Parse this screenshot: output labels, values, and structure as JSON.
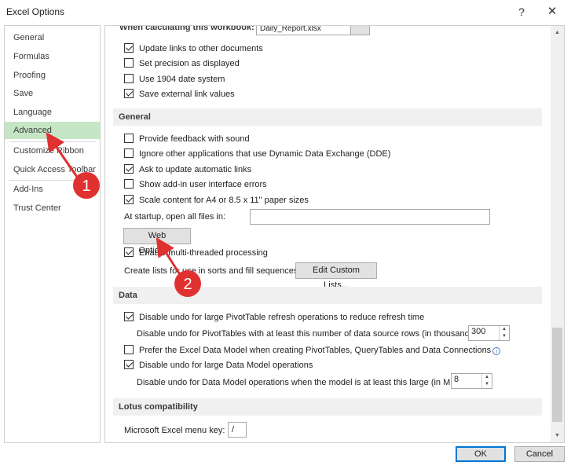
{
  "window": {
    "title": "Excel Options",
    "help_glyph": "?",
    "close_glyph": "✕"
  },
  "sidebar": {
    "items": [
      {
        "label": "General"
      },
      {
        "label": "Formulas"
      },
      {
        "label": "Proofing"
      },
      {
        "label": "Save"
      },
      {
        "label": "Language"
      },
      {
        "label": "Advanced",
        "selected": true
      },
      {
        "label": "Customize Ribbon"
      },
      {
        "label": "Quick Access Toolbar"
      },
      {
        "label": "Add-Ins"
      },
      {
        "label": "Trust Center"
      }
    ]
  },
  "workbook": {
    "cut_header": "When calculating this workbook:",
    "combo_value": "Daily_Report.xlsx",
    "options": [
      {
        "label": "Update links to other documents",
        "checked": true
      },
      {
        "label": "Set precision as displayed",
        "checked": false
      },
      {
        "label": "Use 1904 date system",
        "checked": false
      },
      {
        "label": "Save external link values",
        "checked": true
      }
    ]
  },
  "general": {
    "header": "General",
    "options": [
      {
        "label": "Provide feedback with sound",
        "checked": false
      },
      {
        "label": "Ignore other applications that use Dynamic Data Exchange (DDE)",
        "checked": false
      },
      {
        "label": "Ask to update automatic links",
        "checked": true
      },
      {
        "label": "Show add-in user interface errors",
        "checked": false
      },
      {
        "label": "Scale content for A4 or 8.5 x 11\" paper sizes",
        "checked": true
      }
    ],
    "startup_label": "At startup, open all files in:",
    "startup_value": "",
    "web_options_label": "Web Options...",
    "multithreaded_label": "Enable multi-threaded processing",
    "multithreaded_checked": true,
    "custom_lists_label": "Create lists for use in sorts and fill sequences:",
    "edit_custom_lists_label": "Edit Custom Lists..."
  },
  "data": {
    "header": "Data",
    "disable_undo_pivot_label": "Disable undo for large PivotTable refresh operations to reduce refresh time",
    "disable_undo_pivot_checked": true,
    "pivot_rows_label": "Disable undo for PivotTables with at least this number of data source rows (in thousands):",
    "pivot_rows_value": "300",
    "prefer_data_model_label": "Prefer the Excel Data Model when creating PivotTables, QueryTables and Data Connections",
    "prefer_data_model_checked": false,
    "info_glyph": "i",
    "disable_undo_model_label": "Disable undo for large Data Model operations",
    "disable_undo_model_checked": true,
    "model_size_label": "Disable undo for Data Model operations when the model is at least this large (in MB):",
    "model_size_value": "8"
  },
  "lotus": {
    "header": "Lotus compatibility",
    "menu_key_label": "Microsoft Excel menu key:",
    "menu_key_value": "/"
  },
  "footer": {
    "ok_label": "OK",
    "cancel_label": "Cancel"
  },
  "annotations": {
    "marker1": "1",
    "marker2": "2",
    "color": "#e03131"
  }
}
